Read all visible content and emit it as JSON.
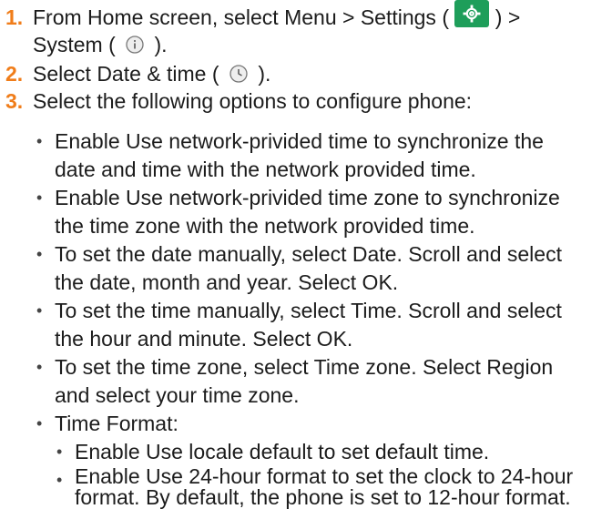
{
  "steps": [
    {
      "number": "1.",
      "line1_a": "From Home screen, select Menu  > Settings  (",
      "line1_b": ") >",
      "line2_a": "System (",
      "line2_b": ")."
    },
    {
      "number": "2.",
      "line1_a": "Select Date & time (",
      "line1_b": ")."
    },
    {
      "number": "3.",
      "line1_a": "Select the following options to configure phone:"
    }
  ],
  "bullets": [
    {
      "lines": [
        "Enable Use network-privided time to synchronize the",
        "date and time with the network provided time."
      ]
    },
    {
      "lines": [
        "Enable Use network-privided time zone to synchronize",
        "the time zone with the network provided time."
      ]
    },
    {
      "lines": [
        "To set the date manually, select Date. Scroll and select",
        "the date, month and year. Select OK."
      ]
    },
    {
      "lines": [
        "To set the time manually, select Time. Scroll and select",
        "the hour and minute. Select OK."
      ]
    },
    {
      "lines": [
        "To set the time zone, select Time zone. Select Region",
        "and select your time zone."
      ]
    },
    {
      "lines": [
        "Time Format:"
      ]
    }
  ],
  "sub_bullets": [
    {
      "lines": [
        "Enable Use locale default to set default time."
      ]
    },
    {
      "lines": [
        "Enable Use 24-hour format to set the clock to 24-hour",
        "format. By default, the phone is set to 12-hour format."
      ]
    }
  ],
  "colors": {
    "step_number": "#f07d1a",
    "settings_icon_bg": "#1e9e5a"
  },
  "icons": {
    "settings": "gear-icon",
    "system": "info-icon",
    "date_time": "clock-icon"
  }
}
